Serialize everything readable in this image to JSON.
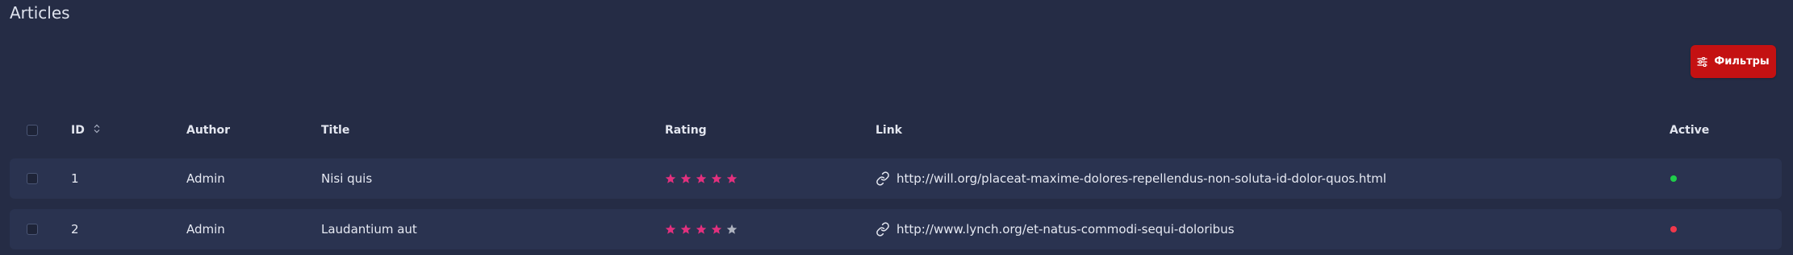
{
  "page": {
    "title": "Articles"
  },
  "toolbar": {
    "filters_label": "Фильтры"
  },
  "table": {
    "columns": {
      "id": "ID",
      "author": "Author",
      "title": "Title",
      "rating": "Rating",
      "link": "Link",
      "active": "Active"
    },
    "rows": [
      {
        "id": "1",
        "author": "Admin",
        "title": "Nisi quis",
        "rating": 5,
        "link": "http://will.org/placeat-maxime-dolores-repellendus-non-soluta-id-dolor-quos.html",
        "active": true
      },
      {
        "id": "2",
        "author": "Admin",
        "title": "Laudantium aut",
        "rating": 4,
        "link": "http://www.lynch.org/et-natus-commodi-sequi-doloribus",
        "active": false
      }
    ]
  },
  "colors": {
    "background": "#252c45",
    "row_background": "#2a3350",
    "accent_button": "#c41112",
    "star_filled": "#e2307e",
    "star_empty": "#aeb3bf",
    "active_true": "#1fce4a",
    "active_false": "#f0384b"
  },
  "icons": {
    "filters": "sliders-icon",
    "sort": "sort-icon",
    "link": "link-icon",
    "star": "star-icon"
  }
}
